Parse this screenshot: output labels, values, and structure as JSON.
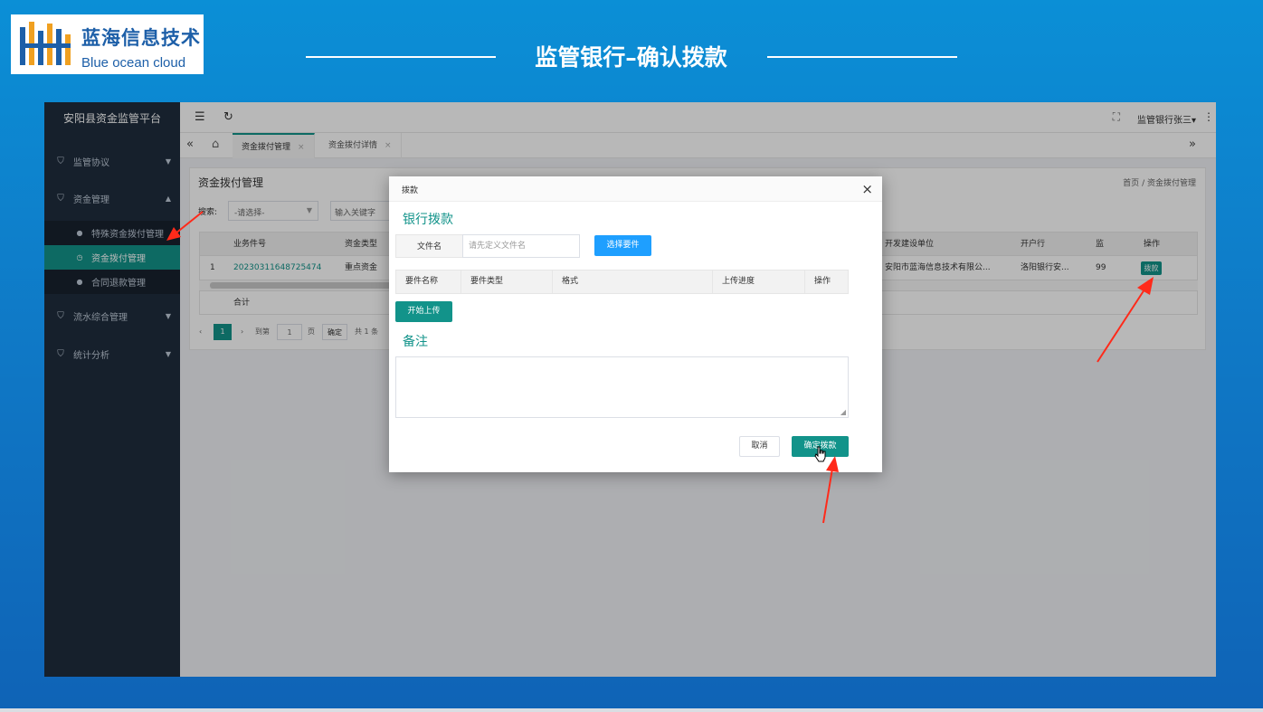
{
  "logo": {
    "name_cn": "蓝海信息技术",
    "name_en": "Blue ocean cloud"
  },
  "slide_title": "监管银行–确认拨款",
  "app": {
    "platform_title": "安阳县资金监管平台",
    "user": "监管银行张三",
    "sidebar": {
      "items": [
        {
          "label": "监管协议",
          "icon": "shield-check-icon"
        },
        {
          "label": "资金管理",
          "icon": "shield-check-icon",
          "expanded": true
        },
        {
          "label": "流水综合管理",
          "icon": "shield-check-icon"
        },
        {
          "label": "统计分析",
          "icon": "shield-check-icon"
        }
      ],
      "sub_items": [
        {
          "label": "特殊资金拨付管理",
          "active": false
        },
        {
          "label": "资金拨付管理",
          "active": true
        },
        {
          "label": "合同退款管理",
          "active": false
        }
      ]
    },
    "tabs": [
      {
        "label": "资金拨付管理",
        "active": true
      },
      {
        "label": "资金拨付详情",
        "active": false
      }
    ],
    "page": {
      "title": "资金拨付管理",
      "breadcrumb": {
        "home": "首页",
        "separator": "/",
        "current": "资金拨付管理"
      },
      "search_label": "搜索:",
      "select_placeholder": "-请选择-",
      "keyword_placeholder": "输入关键字",
      "table": {
        "headers": {
          "business_no": "业务件号",
          "fund_type": "资金类型",
          "developer": "开发建设单位",
          "bank": "开户行",
          "supervise": "监",
          "action": "操作"
        },
        "row": {
          "index": "1",
          "business_no": "20230311648725474",
          "fund_type": "重点资金",
          "developer": "安阳市蓝海信息技术有限公...",
          "bank": "洛阳银行安...",
          "supervise": "99",
          "action": "拨款"
        },
        "total_label": "合计"
      },
      "pager": {
        "current": "1",
        "goto_label": "到第",
        "page_input": "1",
        "page_unit": "页",
        "confirm": "确定",
        "total": "共 1 条"
      }
    },
    "dialog": {
      "title": "拨款",
      "section_bank": "银行拨款",
      "file_label": "文件名",
      "file_placeholder": "请先定义文件名",
      "select_file_button": "选择要件",
      "upload_headers": [
        "要件名称",
        "要件类型",
        "格式",
        "上传进度",
        "操作"
      ],
      "start_upload_button": "开始上传",
      "section_remark": "备注",
      "cancel_button": "取消",
      "confirm_button": "确定拨款"
    }
  },
  "colors": {
    "accent": "#12938a",
    "blue_button": "#1e9fff",
    "sidebar": "#1f2d3d",
    "annotation_arrow": "#ff2a1a"
  }
}
